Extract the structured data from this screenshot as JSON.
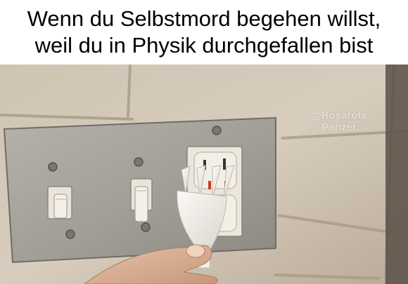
{
  "caption": {
    "line1": "Wenn du Selbstmord begehen willst,",
    "line2": "weil du in Physik durchgefallen bist"
  },
  "photo": {
    "depicts": [
      "wall-plate",
      "light-switches",
      "power-outlet",
      "plastic-fork",
      "hand"
    ],
    "watermark": {
      "line1": "@Rosarote",
      "line2": "Panzer"
    }
  }
}
